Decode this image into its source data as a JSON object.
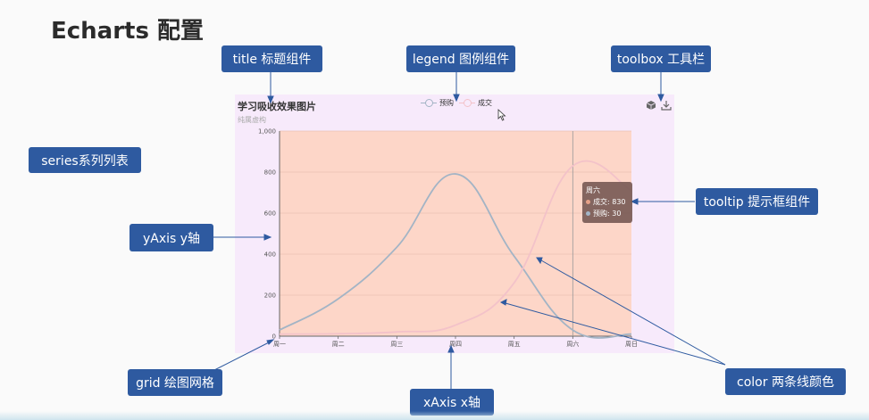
{
  "page": {
    "title": "Echarts 配置"
  },
  "annotations": {
    "title": "title 标题组件",
    "legend": "legend 图例组件",
    "toolbox": "toolbox 工具栏",
    "series": "series系列列表",
    "yaxis": "yAxis y轴",
    "tooltip": "tooltip 提示框组件",
    "grid": "grid 绘图网格",
    "xaxis": "xAxis x轴",
    "color": "color 两条线颜色"
  },
  "chart": {
    "title": "学习吸收效果图片",
    "subtitle": "纯属虚构",
    "legend": [
      "预购",
      "成交"
    ],
    "toolbox_icons": [
      "cube-icon",
      "download-icon"
    ],
    "tooltip": {
      "title": "周六",
      "rows": [
        {
          "label": "成交: 830",
          "color": "#e6a188"
        },
        {
          "label": "预购: 30",
          "color": "#a3b4c5"
        }
      ]
    }
  },
  "colors": {
    "label_bg": "#2e5aa0",
    "panel_bg": "#f7eafb",
    "grid_bg": "#fdd6c8",
    "series_presale": "#a3b4c5",
    "series_deal": "#f3c2c9"
  },
  "chart_data": {
    "type": "line",
    "title": "学习吸收效果图片",
    "subtitle": "纯属虚构",
    "categories": [
      "周一",
      "周二",
      "周三",
      "周四",
      "周五",
      "周六",
      "周日"
    ],
    "yticks": [
      "0",
      "200",
      "400",
      "600",
      "800",
      "1,000"
    ],
    "ylim": [
      0,
      1000
    ],
    "grid": true,
    "legend_position": "top",
    "series": [
      {
        "name": "预购",
        "values": [
          30,
          182,
          434,
          791,
          390,
          30,
          10
        ],
        "color": "#a3b4c5"
      },
      {
        "name": "成交",
        "values": [
          10,
          12,
          21,
          54,
          260,
          830,
          710
        ],
        "color": "#f3c2c9"
      }
    ],
    "highlight_category": "周六"
  }
}
